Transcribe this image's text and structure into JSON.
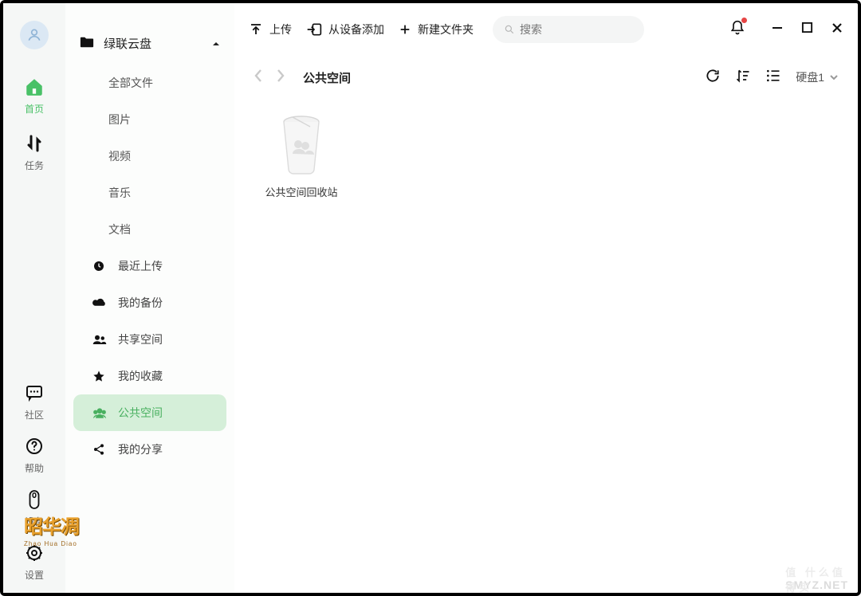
{
  "rail": {
    "home": "首页",
    "tasks": "任务",
    "community": "社区",
    "help": "帮助",
    "device": "设备",
    "settings": "设置"
  },
  "sidebar": {
    "drive_name": "绿联云盘",
    "items": [
      {
        "label": "全部文件"
      },
      {
        "label": "图片"
      },
      {
        "label": "视频"
      },
      {
        "label": "音乐"
      },
      {
        "label": "文档"
      },
      {
        "label": "最近上传"
      },
      {
        "label": "我的备份"
      },
      {
        "label": "共享空间"
      },
      {
        "label": "我的收藏"
      },
      {
        "label": "公共空间"
      },
      {
        "label": "我的分享"
      }
    ]
  },
  "toolbar": {
    "upload": "上传",
    "add_from_device": "从设备添加",
    "new_folder": "新建文件夹",
    "search_placeholder": "搜索"
  },
  "breadcrumb": {
    "title": "公共空间",
    "disk": "硬盘1"
  },
  "files": [
    {
      "name": "公共空间回收站"
    }
  ],
  "watermark": {
    "brand": "昭华凋",
    "brand_sub": "Zhao Hua Diao",
    "site": "SMYZ.NET",
    "site_cn": "值   什么值得买"
  }
}
